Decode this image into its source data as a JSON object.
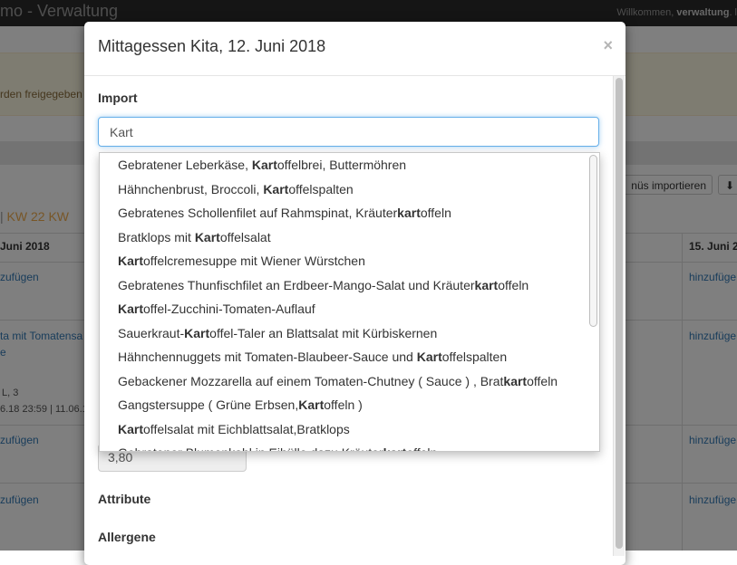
{
  "app": {
    "brand": "mo - Verwaltung",
    "welcome_prefix": "Willkommen, ",
    "welcome_user": "verwaltung",
    "welcome_suffix": ". l"
  },
  "background": {
    "alert_text": "rden freigegeben",
    "import_button": "nüs importieren",
    "kw_sep": "|",
    "kw_current": "KW 22",
    "kw_next": "KW",
    "col_left_header": "Juni 2018",
    "col_right_header": "15. Juni 20",
    "rows_left": [
      "zufügen",
      "ta mit Tomatensa",
      "e",
      "L, 3",
      "6.18 23:59 | 11.06.1",
      "zufügen",
      "zufügen"
    ],
    "rows_right": [
      "hinzufüge",
      "hinzufüge",
      "hinzufüge",
      "hinzufüge"
    ]
  },
  "modal": {
    "title": "Mittagessen Kita, 12. Juni 2018",
    "close_symbol": "×",
    "import_label": "Import",
    "import_value": "Kart",
    "price_value": "3,80",
    "attribute_label": "Attribute",
    "allergene_label": "Allergene"
  },
  "dropdown": {
    "items": [
      {
        "before": "Gebratener Leberkäse, ",
        "match": "Kart",
        "after": "offelbrei, Buttermöhren"
      },
      {
        "before": "Hähnchenbrust, Broccoli, ",
        "match": "Kart",
        "after": "offelspalten"
      },
      {
        "before": "Gebratenes Schollenfilet auf Rahmspinat, Kräuter",
        "match": "kart",
        "after": "offeln"
      },
      {
        "before": "Bratklops mit ",
        "match": "Kart",
        "after": "offelsalat"
      },
      {
        "before": "",
        "match": "Kart",
        "after": "offelcremesuppe mit Wiener Würstchen"
      },
      {
        "before": "Gebratenes Thunfischfilet an Erdbeer-Mango-Salat und Kräuter",
        "match": "kart",
        "after": "offeln"
      },
      {
        "before": "",
        "match": "Kart",
        "after": "offel-Zucchini-Tomaten-Auflauf"
      },
      {
        "before": "Sauerkraut-",
        "match": "Kart",
        "after": "offel-Taler an Blattsalat mit Kürbiskernen"
      },
      {
        "before": "Hähnchennuggets mit Tomaten-Blaubeer-Sauce und ",
        "match": "Kart",
        "after": "offelspalten"
      },
      {
        "before": "Gebackener Mozzarella auf einem Tomaten-Chutney ( Sauce ) , Brat",
        "match": "kart",
        "after": "offeln"
      },
      {
        "before": "Gangstersuppe ( Grüne Erbsen,",
        "match": "Kart",
        "after": "offeln )"
      },
      {
        "before": "",
        "match": "Kart",
        "after": "offelsalat mit Eichblattsalat,Bratklops"
      },
      {
        "before": "Gebratener Blumenkohl in Eihülle dazu Kräuter",
        "match": "kart",
        "after": "offeln"
      }
    ]
  }
}
